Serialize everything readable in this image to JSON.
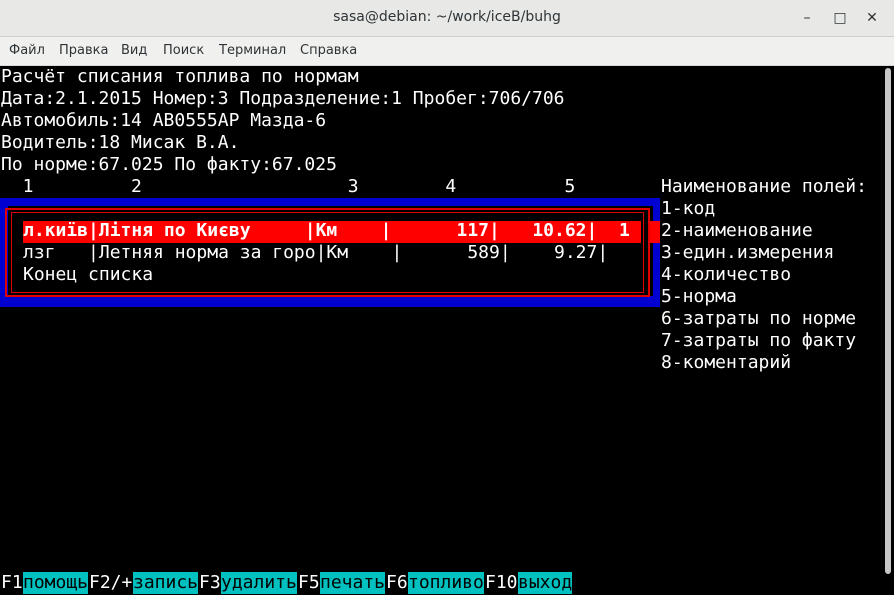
{
  "window": {
    "title": "sasa@debian: ~/work/iceB/buhg"
  },
  "menu": [
    "Файл",
    "Правка",
    "Вид",
    "Поиск",
    "Терминал",
    "Справка"
  ],
  "header_lines": [
    "Расчёт списания топлива по нормам",
    "Дата:2.1.2015 Номер:3 Подразделение:1 Пробег:706/706",
    "Автомобиль:14 AB0555AP Мазда-6",
    "Водитель:18 Мисак В.А.",
    "По норме:67.025 По факту:67.025"
  ],
  "column_numbers": "  1         2                   3        4          5",
  "rows": [
    {
      "text": "л.київ|Літня по Києву     |Км    |      117|   10.62|  1",
      "selected": true
    },
    {
      "text": "лзг   |Летняя норма за горо|Км    |      589|    9.27|",
      "selected": false
    },
    {
      "text": "Конец списка",
      "selected": false
    }
  ],
  "legend": {
    "title": "Наименование полей:",
    "items": [
      "1-код",
      "2-наименование",
      "3-един.измерения",
      "4-количество",
      "5-норма",
      "6-затраты по норме",
      "7-затраты по факту",
      "8-коментарий"
    ]
  },
  "function_keys": [
    {
      "key": "F1",
      "label": "помощь"
    },
    {
      "key": "F2/+",
      "label": "запись"
    },
    {
      "key": "F3",
      "label": "удалить"
    },
    {
      "key": "F5",
      "label": "печать"
    },
    {
      "key": "F6",
      "label": "топливо"
    },
    {
      "key": "F10",
      "label": "выход"
    }
  ]
}
